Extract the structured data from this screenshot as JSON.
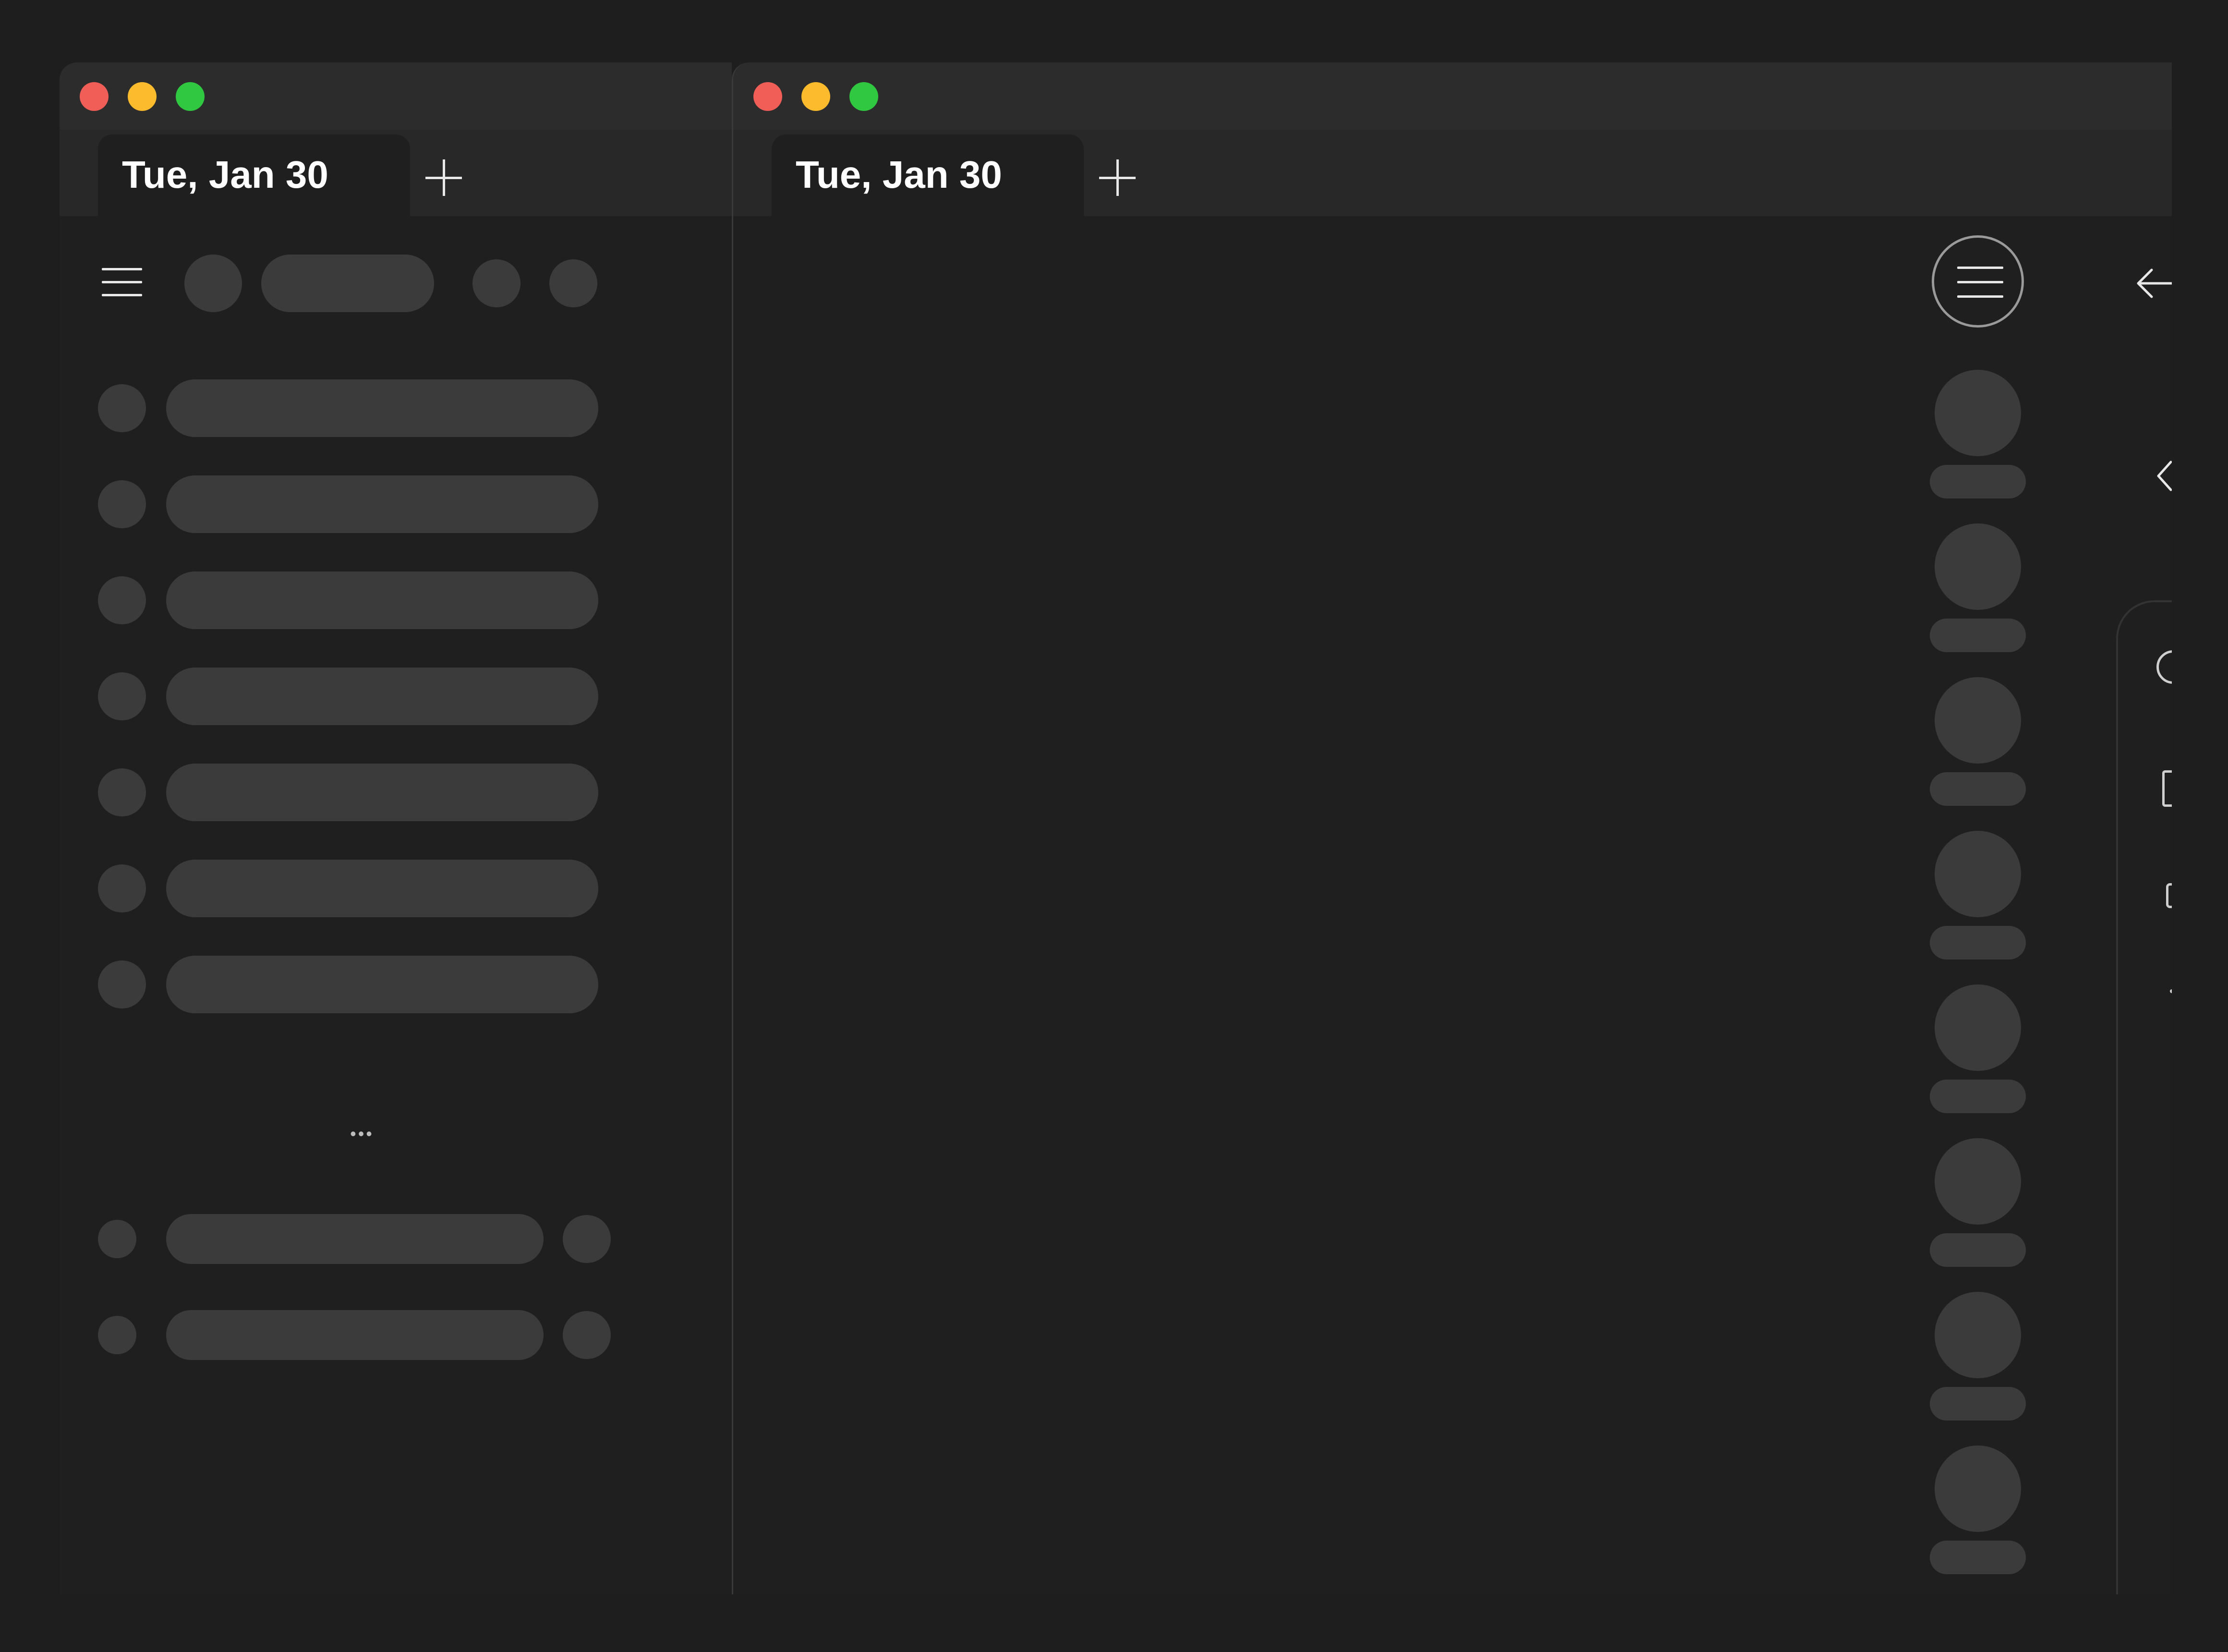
{
  "windows": [
    {
      "tab_title": "Tue, Jan 30",
      "new_tab_label": "+"
    },
    {
      "tab_title": "Tue, Jan 30",
      "new_tab_label": "+"
    }
  ],
  "traffic_light_colors": {
    "close": "#f05e57",
    "minimize": "#fbbb2d",
    "zoom": "#2fc840"
  },
  "more_label": "•••",
  "icons": [
    "menu-icon",
    "back-arrow-icon",
    "chevron-left-icon"
  ]
}
